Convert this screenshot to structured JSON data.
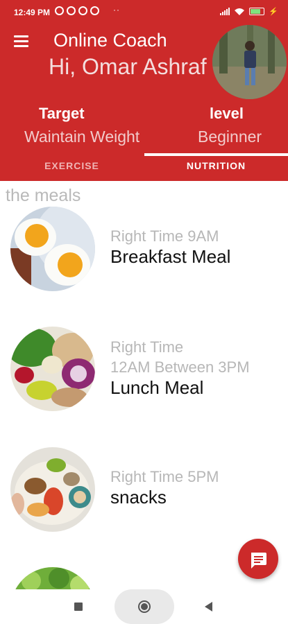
{
  "status_bar": {
    "time": "12:49 PM",
    "dots": "··",
    "icons": [
      "alarm-icon",
      "whatsapp-icon",
      "app-icon",
      "notification-icon",
      "signal-icon",
      "wifi-icon",
      "battery-icon",
      "charging-icon"
    ],
    "battery_level": 0.7
  },
  "header": {
    "app_title": "Online Coach",
    "greeting": "Hi, Omar Ashraf",
    "target_label": "Target",
    "target_value": "Waintain Weight",
    "level_label": "level",
    "level_value": "Beginner"
  },
  "tabs": [
    {
      "label": "EXERCISE",
      "active": false
    },
    {
      "label": "NUTRITION",
      "active": true
    }
  ],
  "main": {
    "section_title": "the meals",
    "meals": [
      {
        "time": "Right Time 9AM",
        "time2": "",
        "name": "Breakfast Meal",
        "image": "eggs-breakfast-plate"
      },
      {
        "time": "Right Time",
        "time2": "12AM Between 3PM",
        "name": "Lunch Meal",
        "image": "salad-lunch-bowl"
      },
      {
        "time": "Right Time 5PM",
        "time2": "",
        "name": "snacks",
        "image": "snack-platter"
      },
      {
        "time": "",
        "time2": "",
        "name": "",
        "image": "green-salad"
      }
    ]
  },
  "fab": {
    "icon": "chat-icon"
  },
  "colors": {
    "primary": "#cc2a2a",
    "muted_text": "#b7b7b7",
    "text": "#111111"
  }
}
